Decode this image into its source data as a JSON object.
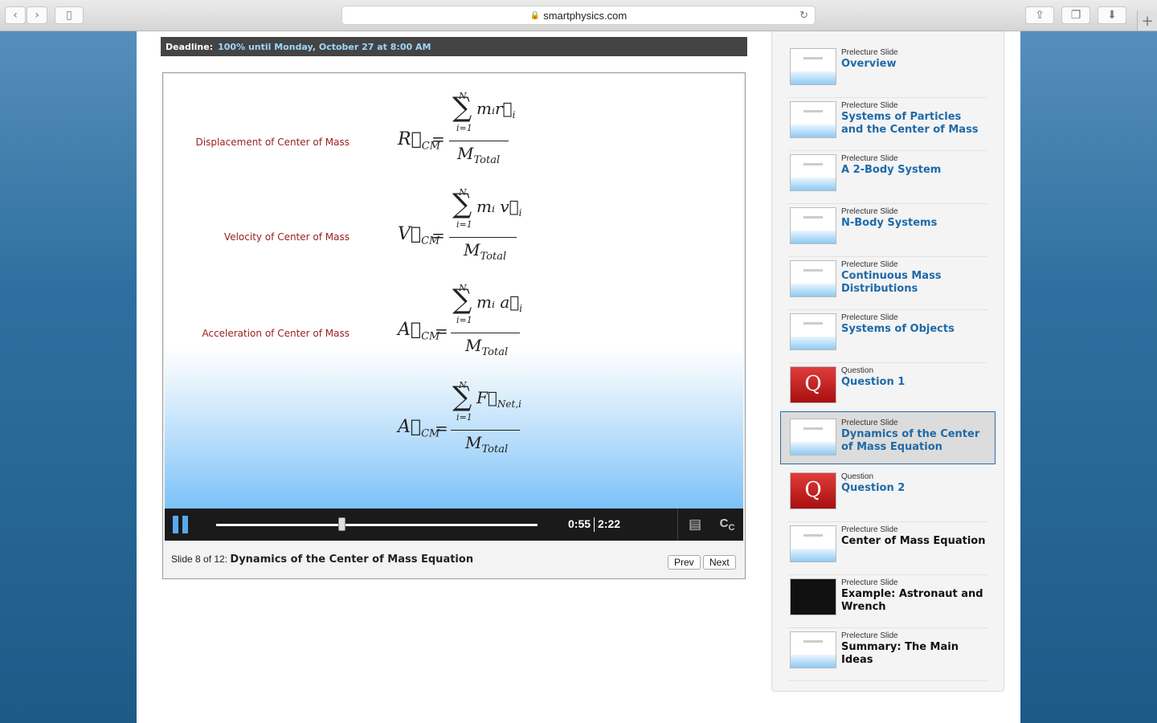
{
  "browser": {
    "url": "smartphysics.com",
    "back_icon": "‹",
    "forward_icon": "›",
    "sidebar_icon": "▯",
    "reload_icon": "↻",
    "share_icon": "⇪",
    "tabs_icon": "❐",
    "download_icon": "⬇",
    "newtab_icon": "+"
  },
  "deadline": {
    "label": "Deadline:",
    "value": "100% until Monday, October 27 at 8:00 AM"
  },
  "slide": {
    "equations": [
      {
        "label": "Displacement of Center of Mass",
        "lhs": "R⃗",
        "lhs_sub": "CM",
        "upper": "N",
        "lower": "i=1",
        "numerator": "mᵢr⃗",
        "numerator_sub": "i",
        "denominator": "M",
        "denominator_sub": "Total"
      },
      {
        "label": "Velocity of Center of Mass",
        "lhs": "V⃗",
        "lhs_sub": "CM",
        "upper": "N",
        "lower": "i=1",
        "numerator": "mᵢ v⃗",
        "numerator_sub": "i",
        "denominator": "M",
        "denominator_sub": "Total"
      },
      {
        "label": "Acceleration of Center of Mass",
        "lhs": "A⃗",
        "lhs_sub": "CM",
        "upper": "N",
        "lower": "i=1",
        "numerator": "mᵢ a⃗",
        "numerator_sub": "i",
        "denominator": "M",
        "denominator_sub": "Total"
      },
      {
        "label": "",
        "lhs": "A⃗",
        "lhs_sub": "CM",
        "upper": "N",
        "lower": "i=1",
        "numerator": "F⃗",
        "numerator_sub": "Net,i",
        "denominator": "M",
        "denominator_sub": "Total"
      }
    ]
  },
  "player": {
    "current_time": "0:55",
    "total_time": "2:22",
    "progress": 0.39,
    "pause_icon": "pause-icon",
    "transcript_icon": "▤",
    "cc_icon": "cc",
    "caption_prefix": "Slide 8 of 12:",
    "caption_title": "Dynamics of the Center of Mass Equation",
    "prev_label": "Prev",
    "next_label": "Next"
  },
  "sidebar": {
    "items": [
      {
        "type": "Prelecture Slide",
        "title": "Overview",
        "thumb": "slide"
      },
      {
        "type": "Prelecture Slide",
        "title": "Systems of Particles and the Center of Mass",
        "thumb": "slide"
      },
      {
        "type": "Prelecture Slide",
        "title": "A 2-Body System",
        "thumb": "slide"
      },
      {
        "type": "Prelecture Slide",
        "title": "N-Body Systems",
        "thumb": "slide"
      },
      {
        "type": "Prelecture Slide",
        "title": "Continuous Mass Distributions",
        "thumb": "slide"
      },
      {
        "type": "Prelecture Slide",
        "title": "Systems of Objects",
        "thumb": "slide"
      },
      {
        "type": "Question",
        "title": "Question 1",
        "thumb": "question"
      },
      {
        "type": "Prelecture Slide",
        "title": "Dynamics of the Center of Mass Equation",
        "thumb": "slide",
        "active": true
      },
      {
        "type": "Question",
        "title": "Question 2",
        "thumb": "question"
      },
      {
        "type": "Prelecture Slide",
        "title": "Center of Mass Equation",
        "thumb": "slide",
        "unvisited": true
      },
      {
        "type": "Prelecture Slide",
        "title": "Example: Astronaut and Wrench",
        "thumb": "dark",
        "unvisited": true
      },
      {
        "type": "Prelecture Slide",
        "title": "Summary: The Main Ideas",
        "thumb": "slide",
        "unvisited": true
      }
    ],
    "question_letter": "Q"
  },
  "colors": {
    "accent": "#1f6aa8",
    "label_red": "#9b1c1c",
    "player_progress": "#5aa8f0"
  }
}
